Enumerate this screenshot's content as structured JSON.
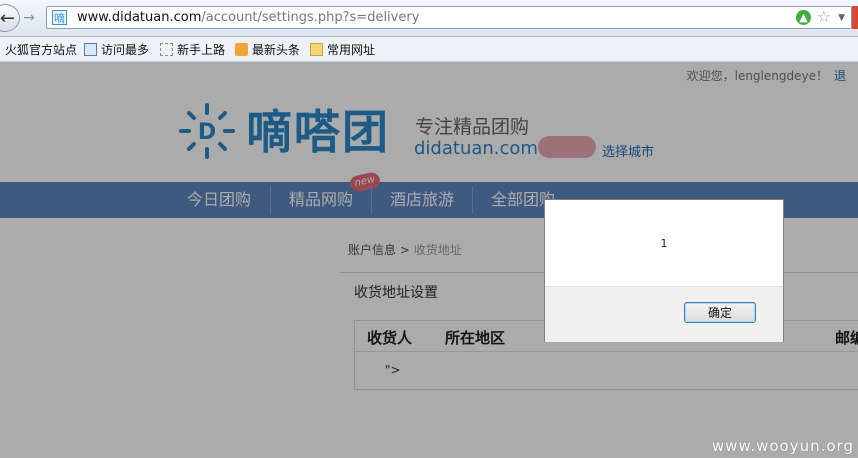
{
  "browser": {
    "url_host": "www.didatuan.com",
    "url_path": "/account/settings.php?s=delivery",
    "favicon_char": "嘀"
  },
  "bookmarks": [
    {
      "label": "火狐官方站点",
      "icon": "firefox-icon"
    },
    {
      "label": "访问最多",
      "icon": "most-visited-icon"
    },
    {
      "label": "新手上路",
      "icon": "getting-started-icon"
    },
    {
      "label": "最新头条",
      "icon": "rss-feed-icon"
    },
    {
      "label": "常用网址",
      "icon": "folder-icon"
    }
  ],
  "header": {
    "welcome": "欢迎您，lenglengdeye！",
    "welcome_cut": "退",
    "brand_cn": "嘀嗒团",
    "slogan": "专注精品团购",
    "domain": "didatuan.com",
    "city_link": "选择城市"
  },
  "nav": {
    "items": [
      "今日团购",
      "精品网购",
      "酒店旅游",
      "全部团购"
    ],
    "badge": "new"
  },
  "breadcrumb": {
    "parent": "账户信息",
    "sep": " > ",
    "current": "收货地址"
  },
  "section": {
    "title": "收货地址设置"
  },
  "table": {
    "headers": [
      "收货人",
      "所在地区",
      "邮编"
    ],
    "row_cell": "\">"
  },
  "dialog": {
    "message": "1",
    "ok_label": "确定"
  },
  "watermark": "www.wooyun.org",
  "colors": {
    "nav": "#5f86bf",
    "brand": "#2a86c9",
    "overlay": "rgba(0,0,0,0.33)"
  }
}
